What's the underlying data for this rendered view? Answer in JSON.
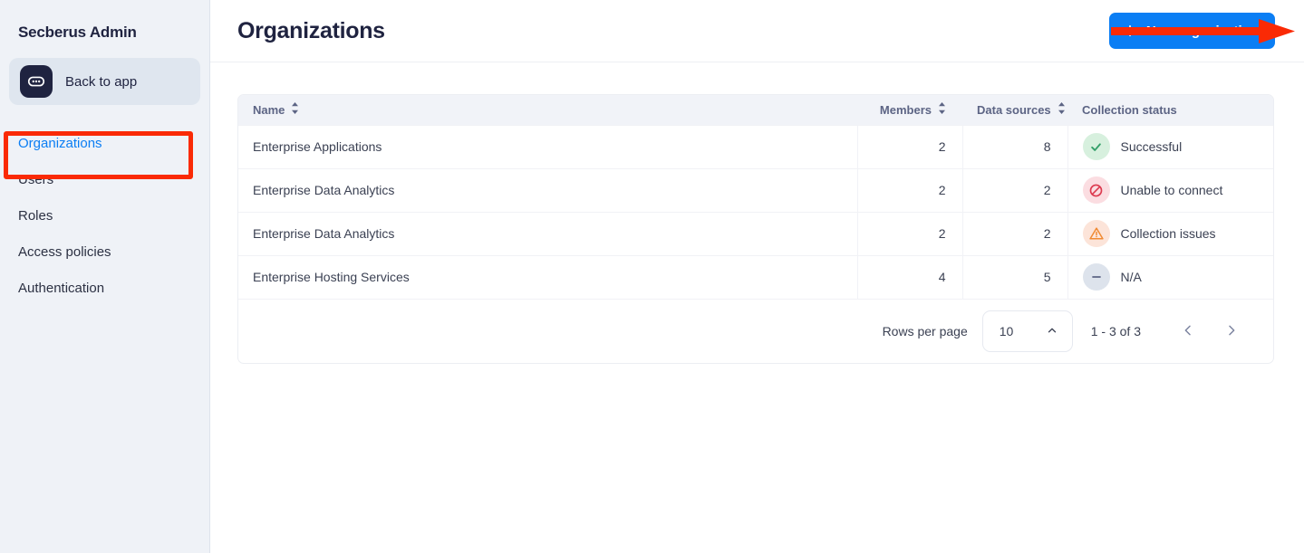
{
  "sidebar": {
    "brand": "Secberus Admin",
    "back_to_app": {
      "label": "Back to app",
      "icon": "chat-pill-icon"
    },
    "items": [
      {
        "label": "Organizations",
        "active": true
      },
      {
        "label": "Users",
        "active": false
      },
      {
        "label": "Roles",
        "active": false
      },
      {
        "label": "Access policies",
        "active": false
      },
      {
        "label": "Authentication",
        "active": false
      }
    ]
  },
  "header": {
    "title": "Organizations",
    "new_org_button": {
      "label": "New organization",
      "icon": "plus-icon"
    }
  },
  "annotations": {
    "arrow_color": "#fa2a05",
    "box_color": "#fa2a05",
    "arrow_target": "New organization",
    "box_target": "Organizations"
  },
  "table": {
    "columns": [
      {
        "label": "Name",
        "sortable": true,
        "align": "left"
      },
      {
        "label": "Members",
        "sortable": true,
        "align": "right"
      },
      {
        "label": "Data sources",
        "sortable": true,
        "align": "right"
      },
      {
        "label": "Collection status",
        "sortable": false,
        "align": "left"
      }
    ],
    "rows": [
      {
        "name": "Enterprise Applications",
        "members": "2",
        "data_sources": "8",
        "status": "Successful",
        "status_kind": "success"
      },
      {
        "name": "Enterprise Data Analytics",
        "members": "2",
        "data_sources": "2",
        "status": "Unable to connect",
        "status_kind": "error"
      },
      {
        "name": "Enterprise Data Analytics",
        "members": "2",
        "data_sources": "2",
        "status": "Collection issues",
        "status_kind": "warning"
      },
      {
        "name": "Enterprise Hosting Services",
        "members": "4",
        "data_sources": "5",
        "status": "N/A",
        "status_kind": "neutral"
      }
    ]
  },
  "pagination": {
    "rows_per_page_label": "Rows per page",
    "rows_per_page_value": "10",
    "range_label": "1 - 3 of 3",
    "prev_icon": "chevron-left-icon",
    "next_icon": "chevron-right-icon",
    "select_icon": "chevron-up-icon"
  },
  "colors": {
    "accent": "#0b7ef4",
    "sidebar_bg": "#eff2f7",
    "header_row_bg": "#f1f3f8",
    "success_bg": "#d7f0de",
    "success_fg": "#34a06a",
    "error_bg": "#fbdde1",
    "error_fg": "#dc3a4f",
    "warning_bg": "#fce4d9",
    "warning_fg": "#f08a33",
    "neutral_bg": "#dde3ec",
    "neutral_fg": "#5c6484"
  }
}
